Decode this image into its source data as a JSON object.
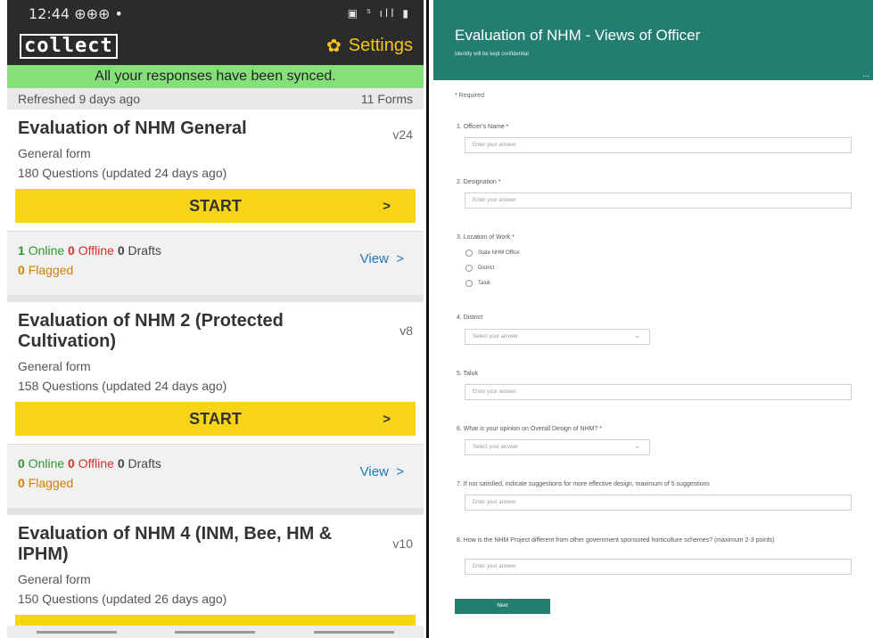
{
  "phone": {
    "status_time": "12:44 ⊕⊕⊕ •",
    "status_icons": "▣ ⁵ ıll ▮",
    "app_logo": "collect",
    "settings_label": "Settings",
    "sync_message": "All your responses have been synced.",
    "refreshed": "Refreshed 9 days ago",
    "forms_count": "11 Forms",
    "forms": [
      {
        "title": "Evaluation of NHM General",
        "version": "v24",
        "subtitle": "General form",
        "questions": "180 Questions (updated 24 days ago)",
        "start_label": "START",
        "online": "1",
        "online_label": "Online",
        "offline": "0",
        "offline_label": "Offline",
        "drafts": "0",
        "drafts_label": "Drafts",
        "flagged": "0",
        "flagged_label": "Flagged",
        "view_label": "View"
      },
      {
        "title": "Evaluation of NHM 2 (Protected Cultivation)",
        "version": "v8",
        "subtitle": "General form",
        "questions": "158 Questions (updated 24 days ago)",
        "start_label": "START",
        "online": "0",
        "online_label": "Online",
        "offline": "0",
        "offline_label": "Offline",
        "drafts": "0",
        "drafts_label": "Drafts",
        "flagged": "0",
        "flagged_label": "Flagged",
        "view_label": "View"
      },
      {
        "title": "Evaluation of NHM 4 (INM, Bee, HM & IPHM)",
        "version": "v10",
        "subtitle": "General form",
        "questions": "150 Questions (updated 26 days ago)"
      }
    ]
  },
  "web": {
    "title": "Evaluation of NHM - Views of Officer",
    "subtitle": "Identity will be kept confidential",
    "dots": "...",
    "required_note": "* Required",
    "q1": "1. Officer's Name *",
    "q2": "2. Designation *",
    "q3": "3. Location of Work *",
    "q3_options": [
      "State NHM Office",
      "District",
      "Taluk"
    ],
    "q4": "4. District",
    "q5": "5. Taluk",
    "q6": "6. What is your opinion on Overall Design of NHM? *",
    "q7": "7. If not satisfied, indicate suggestions for more effective design, maximum of 5 suggestions",
    "q8": "8. How is the NHM Project different from other government sponsored horticulture schemes? (maximum 2-3 points)",
    "input_placeholder": "Enter your answer",
    "select_placeholder": "Select your answer",
    "next_label": "Next"
  },
  "colors": {
    "accent_yellow": "#f8d417",
    "sync_green": "#86e07a",
    "form_header_teal": "#237d70",
    "online_green": "#2e9a2e",
    "offline_red": "#d4312b",
    "flagged_orange": "#d57f00",
    "view_blue": "#1d78b8"
  }
}
